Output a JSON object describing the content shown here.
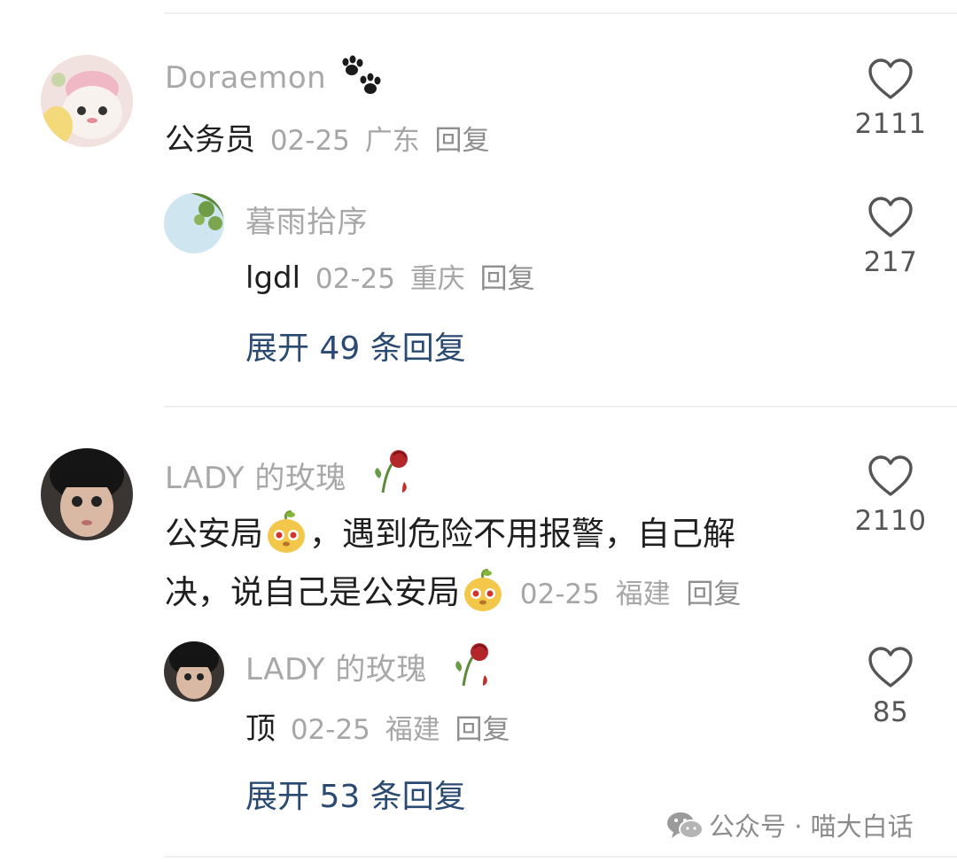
{
  "comments": [
    {
      "user": "Doraemon",
      "text": "公务员",
      "date": "02-25",
      "region": "广东",
      "reply_label": "回复",
      "likes": "2111",
      "reply": {
        "user": "暮雨拾序",
        "text": "lgdl",
        "date": "02-25",
        "region": "重庆",
        "reply_label": "回复",
        "likes": "217"
      },
      "expand_label": "展开 49 条回复"
    },
    {
      "user": "LADY 的玫瑰",
      "text_line1_a": "公安局",
      "text_line1_b": "，遇到危险不用报警，自己解",
      "text_line2": "决，说自己是公安局",
      "date": "02-25",
      "region": "福建",
      "reply_label": "回复",
      "likes": "2110",
      "reply": {
        "user": "LADY 的玫瑰",
        "text": "顶",
        "date": "02-25",
        "region": "福建",
        "reply_label": "回复",
        "likes": "85"
      },
      "expand_label": "展开 53 条回复"
    }
  ],
  "watermark": {
    "text": "公众号 · 喵大白话",
    "icon": "wechat-icon"
  },
  "colors": {
    "link": "#2b4a72",
    "meta": "#a6a6a6",
    "name": "#a8a8a8"
  }
}
